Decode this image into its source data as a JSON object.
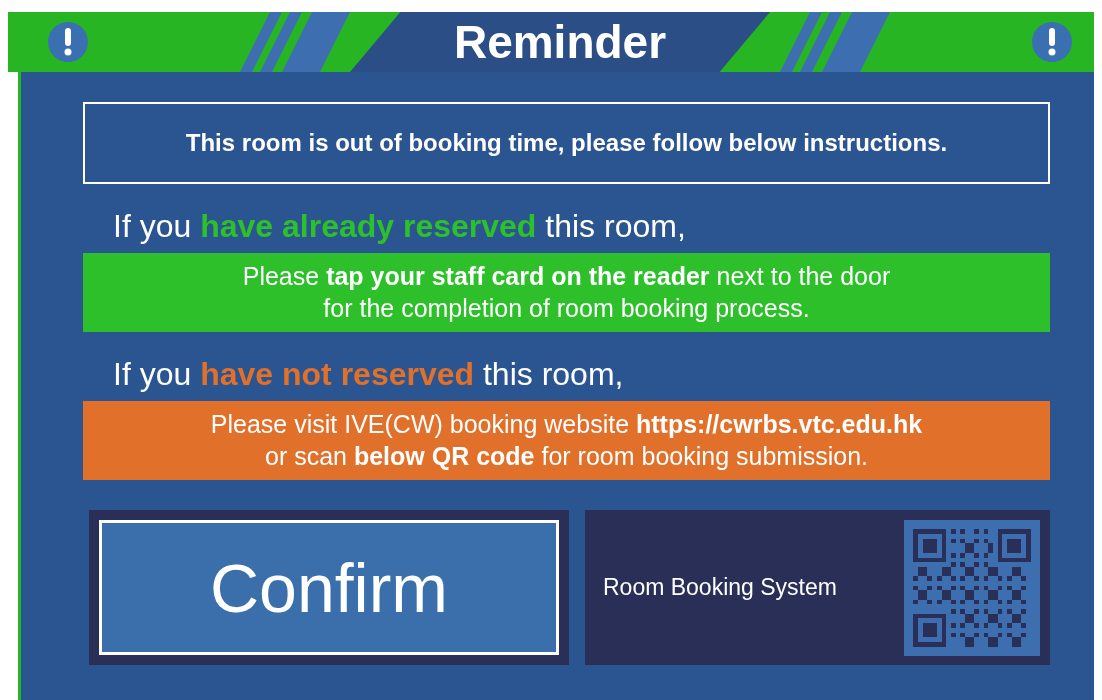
{
  "header": {
    "title": "Reminder"
  },
  "notice": "This room is out of booking time, please follow below instructions.",
  "sections": [
    {
      "lead": "If you",
      "highlight": "have already reserved",
      "tail": "this room,",
      "color": "#2dc02a",
      "lines": [
        "Please **tap your staff card on the reader** next to the door",
        "for the completion of room booking process."
      ]
    },
    {
      "lead": "If you",
      "highlight": "have not reserved",
      "tail": "this room,",
      "color": "#e0702a",
      "lines": [
        "Please visit IVE(CW) booking website **https://cwrbs.vtc.edu.hk**",
        "or scan **below QR code** for room booking submission."
      ]
    }
  ],
  "confirm_button": "Confirm",
  "qr_panel": {
    "label": "Room Booking System"
  }
}
